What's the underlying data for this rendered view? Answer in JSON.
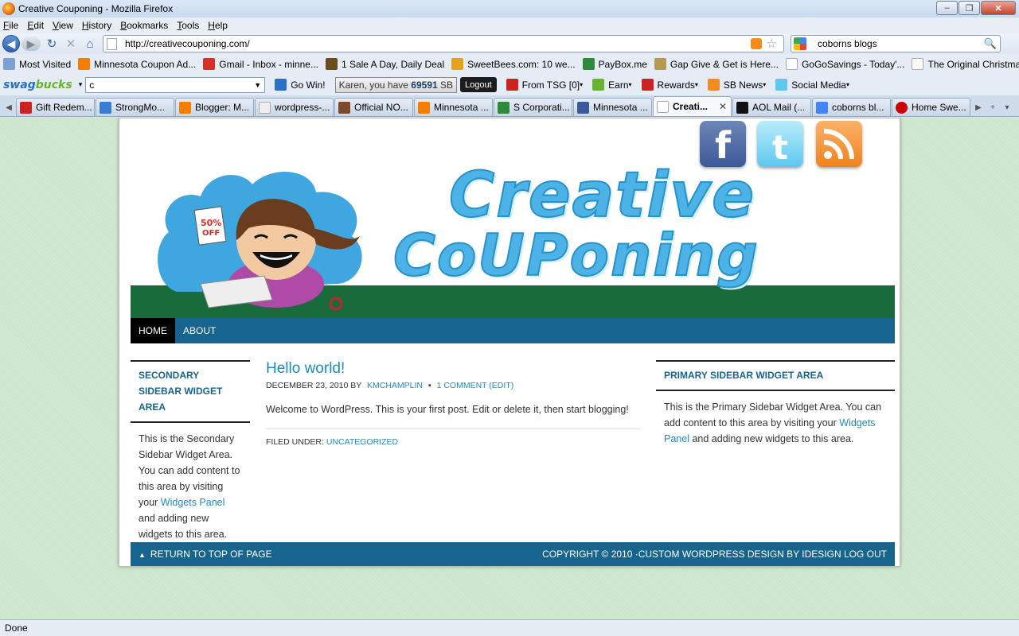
{
  "window": {
    "title": "Creative Couponing - Mozilla Firefox"
  },
  "menu": [
    "File",
    "Edit",
    "View",
    "History",
    "Bookmarks",
    "Tools",
    "Help"
  ],
  "nav": {
    "url": "http://creativecouponing.com/",
    "search_value": "coborns blogs"
  },
  "bookmarks": [
    {
      "label": "Most Visited",
      "color": "#7aa0d6"
    },
    {
      "label": "Minnesota Coupon Ad...",
      "color": "#f57d00"
    },
    {
      "label": "Gmail - Inbox - minne...",
      "color": "#d93025"
    },
    {
      "label": "1 Sale A Day, Daily Deal",
      "color": "#6b4e1e"
    },
    {
      "label": "SweetBees.com: 10 we...",
      "color": "#e4a11b"
    },
    {
      "label": "PayBox.me",
      "color": "#2e8b3a"
    },
    {
      "label": "Gap Give & Get is Here...",
      "color": "#b79a52"
    },
    {
      "label": "GoGoSavings - Today'...",
      "color": "#dddddd"
    },
    {
      "label": "The Original Christma...",
      "color": "#c0c0c0"
    }
  ],
  "swagbar": {
    "logo_a": "swag",
    "logo_b": "bucks",
    "search_value": "c",
    "go_win": "Go Win!",
    "karen_prefix": "Karen, you have ",
    "karen_count": "69591",
    "karen_suffix": " SB",
    "logout": "Logout",
    "items": [
      "From TSG [0]",
      "Earn",
      "Rewards",
      "SB News",
      "Social Media"
    ]
  },
  "tabs": [
    {
      "label": "Gift Redem...",
      "color": "#cc2222",
      "active": false
    },
    {
      "label": "StrongMo...",
      "color": "#3a7bd5",
      "active": false
    },
    {
      "label": "Blogger: M...",
      "color": "#f57d00",
      "active": false
    },
    {
      "label": "wordpress-...",
      "color": "#eeeeee",
      "active": false
    },
    {
      "label": "Official NO...",
      "color": "#7a4a2a",
      "active": false
    },
    {
      "label": "Minnesota ...",
      "color": "#f57d00",
      "active": false
    },
    {
      "label": "S Corporati...",
      "color": "#2e8b3a",
      "active": false
    },
    {
      "label": "Minnesota ...",
      "color": "#3b5998",
      "active": false
    },
    {
      "label": "Creati...",
      "color": "#ffffff",
      "active": true
    },
    {
      "label": "AOL Mail (...",
      "color": "#111111",
      "active": false
    },
    {
      "label": "coborns bl...",
      "color": "#4285f4",
      "active": false
    },
    {
      "label": "Home Swe...",
      "color": "#cc0000",
      "active": false
    }
  ],
  "site": {
    "brand_line1": "Creative",
    "brand_line2": "CoUPoning",
    "nav": [
      {
        "label": "HOME",
        "active": true
      },
      {
        "label": "ABOUT",
        "active": false
      }
    ],
    "secondary_sidebar": {
      "title": "SECONDARY SIDEBAR WIDGET AREA",
      "text_before": "This is the Secondary Sidebar Widget Area. You can add content to this area by visiting your ",
      "link": "Widgets Panel",
      "text_after": " and adding new widgets to this area."
    },
    "post": {
      "title": "Hello world!",
      "date": "DECEMBER 23, 2010",
      "by": "BY",
      "author": "KMCHAMPLIN",
      "comments": "1 COMMENT (EDIT)",
      "body": "Welcome to WordPress. This is your first post. Edit or delete it, then start blogging!",
      "filed_label": "FILED UNDER:",
      "category": "UNCATEGORIZED"
    },
    "primary_sidebar": {
      "title": "PRIMARY SIDEBAR WIDGET AREA",
      "text_before": "This is the Primary Sidebar Widget Area. You can add content to this area by visiting your ",
      "link": "Widgets Panel",
      "text_after": " and adding new widgets to this area."
    },
    "footer": {
      "left": "RETURN TO TOP OF PAGE",
      "right": "COPYRIGHT © 2010 ·CUSTOM WORDPRESS DESIGN BY IDESIGN LOG OUT"
    }
  },
  "status": "Done"
}
